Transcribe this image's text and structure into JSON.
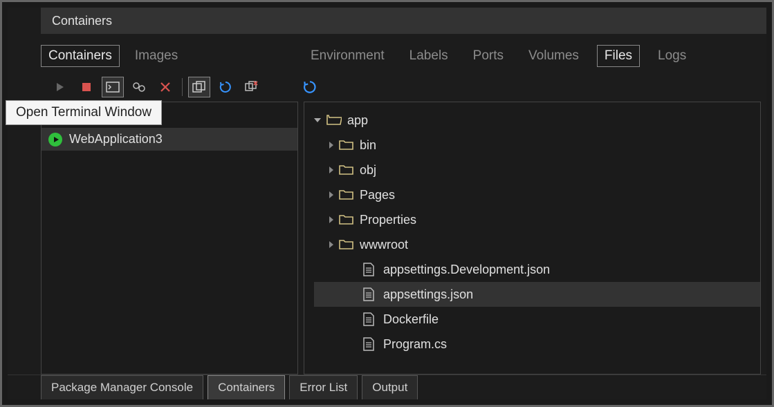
{
  "title": "Containers",
  "tooltip": "Open Terminal Window",
  "leftTabs": [
    {
      "label": "Containers",
      "active": true
    },
    {
      "label": "Images",
      "active": false
    }
  ],
  "rightTabs": [
    {
      "label": "Environment",
      "active": false
    },
    {
      "label": "Labels",
      "active": false
    },
    {
      "label": "Ports",
      "active": false
    },
    {
      "label": "Volumes",
      "active": false
    },
    {
      "label": "Files",
      "active": true
    },
    {
      "label": "Logs",
      "active": false
    }
  ],
  "listHeaderVisible": "s",
  "containerList": [
    {
      "name": "WebApplication3",
      "running": true
    }
  ],
  "tree": {
    "root": "app",
    "children": [
      {
        "name": "bin",
        "type": "folder"
      },
      {
        "name": "obj",
        "type": "folder"
      },
      {
        "name": "Pages",
        "type": "folder"
      },
      {
        "name": "Properties",
        "type": "folder"
      },
      {
        "name": "wwwroot",
        "type": "folder"
      },
      {
        "name": "appsettings.Development.json",
        "type": "file"
      },
      {
        "name": "appsettings.json",
        "type": "file",
        "selected": true
      },
      {
        "name": "Dockerfile",
        "type": "file"
      },
      {
        "name": "Program.cs",
        "type": "file"
      }
    ]
  },
  "bottomTabs": [
    {
      "label": "Package Manager Console",
      "active": false
    },
    {
      "label": "Containers",
      "active": true
    },
    {
      "label": "Error List",
      "active": false
    },
    {
      "label": "Output",
      "active": false
    }
  ]
}
